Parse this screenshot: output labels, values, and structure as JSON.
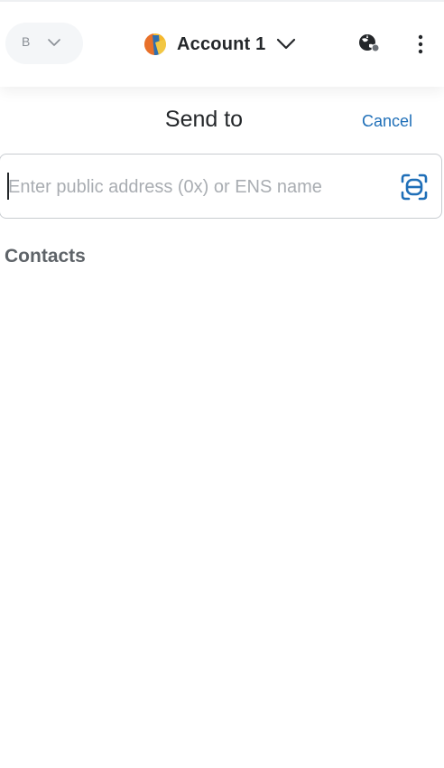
{
  "network": {
    "label": "B"
  },
  "account": {
    "name": "Account 1"
  },
  "icons": {
    "network_chevron": "chevron-down-icon",
    "account_chevron": "chevron-down-icon",
    "connection": "globe-icon",
    "menu": "kebab-menu-icon",
    "scan": "qr-scan-icon"
  },
  "send": {
    "title": "Send to",
    "cancel_label": "Cancel",
    "address_placeholder": "Enter public address (0x) or ENS name",
    "address_value": ""
  },
  "contacts": {
    "title": "Contacts",
    "items": []
  },
  "colors": {
    "accent": "#1f6fb8",
    "text": "#24272a",
    "muted": "#5e6368",
    "border": "#c8ccd0"
  }
}
